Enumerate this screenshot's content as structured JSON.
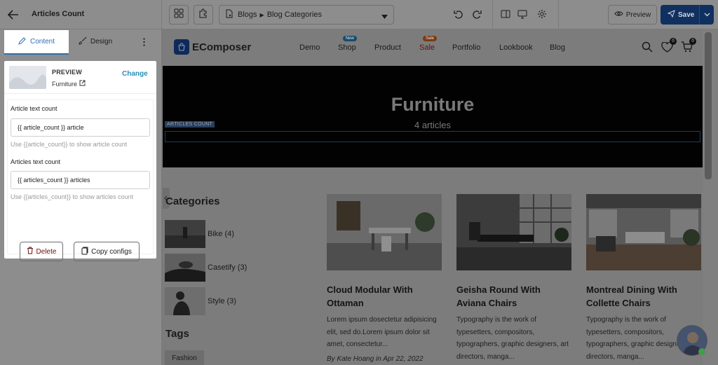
{
  "topbar": {
    "page_title": "Articles Count",
    "breadcrumb": {
      "parent": "Blogs",
      "current": "Blog Categories"
    },
    "preview_label": "Preview",
    "save_label": "Save"
  },
  "panel": {
    "tabs": [
      {
        "label": "Content",
        "active": true
      },
      {
        "label": "Design",
        "active": false
      }
    ],
    "preview": {
      "label": "PREVIEW",
      "name": "Furniture",
      "change_label": "Change"
    },
    "fields": [
      {
        "label": "Article text count",
        "value": "{{ article_count }} article",
        "help": "Use {{article_count}} to show article count"
      },
      {
        "label": "Articles text count",
        "value": "{{ articles_count }} articles",
        "help": "Use {{articles_count}} to show articles count"
      }
    ],
    "actions": {
      "delete_label": "Delete",
      "copy_label": "Copy configs"
    }
  },
  "site": {
    "logo_text": "EComposer",
    "nav": [
      {
        "label": "Demo"
      },
      {
        "label": "Shop",
        "badge": "New",
        "badge_color": "#1b4a6a"
      },
      {
        "label": "Product"
      },
      {
        "label": "Sale",
        "badge": "Sale",
        "badge_color": "#7a3a14",
        "color": "#6b1010"
      },
      {
        "label": "Portfolio"
      },
      {
        "label": "Lookbook"
      },
      {
        "label": "Blog"
      }
    ],
    "wishlist_count": "0",
    "cart_count": "0",
    "hero": {
      "title": "Furniture",
      "subtitle": "4 articles",
      "element_tag": "ARTICLES COUNT"
    },
    "categories": {
      "title": "Categories",
      "items": [
        {
          "label": "Bike (4)"
        },
        {
          "label": "Casetify (3)"
        },
        {
          "label": "Style (3)"
        }
      ]
    },
    "tags": {
      "title": "Tags",
      "items": [
        "Fashion"
      ]
    },
    "posts": [
      {
        "title": "Cloud Modular With Ottaman",
        "excerpt": "Lorem ipsum dosectetur adipisicing elit, sed do.Lorem ipsum dolor sit amet, consectetur...",
        "meta": "By Kate Hoang  in Apr 22, 2022"
      },
      {
        "title": "Geisha Round With Aviana Chairs",
        "excerpt": "Typography is the work of typesetters, compositors, typographers, graphic designers, art directors, manga...",
        "meta": ""
      },
      {
        "title": "Montreal Dining With Collette Chairs",
        "excerpt": "Typography is the work of typesetters, compositors, typographers, graphic designers, art directors, manga...",
        "meta": ""
      }
    ]
  },
  "colors": {
    "accent": "#2a6fb5",
    "save_bg": "#10305f",
    "hero_bg": "#020202",
    "delete": "#6b1010"
  }
}
